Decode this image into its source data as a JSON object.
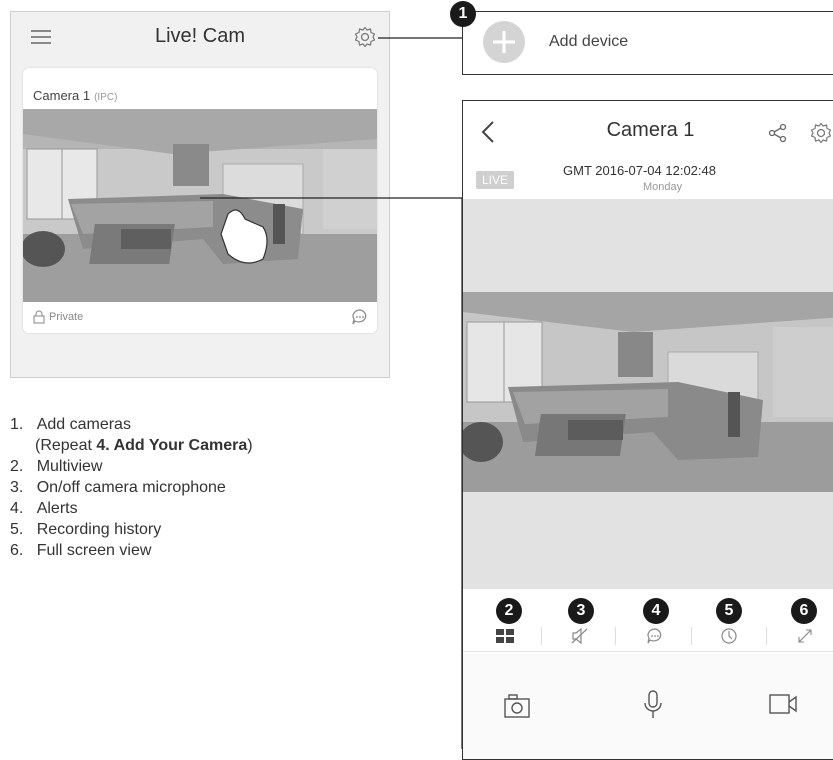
{
  "left_screen": {
    "title": "Live! Cam",
    "camera_name": "Camera 1",
    "camera_type": "(IPC)",
    "private_label": "Private"
  },
  "add_device": {
    "callout_number": "1",
    "label": "Add device"
  },
  "right_screen": {
    "title": "Camera 1",
    "live_badge": "LIVE",
    "timestamp": "GMT  2016-07-04  12:02:48",
    "weekday": "Monday",
    "callouts": [
      "2",
      "3",
      "4",
      "5",
      "6"
    ]
  },
  "instructions": {
    "items": [
      {
        "num": "1.",
        "text": "Add cameras"
      },
      {
        "num": "",
        "text_prefix": "(Repeat ",
        "text_bold": "4. Add Your Camera",
        "text_suffix": ")"
      },
      {
        "num": "2.",
        "text": "Multiview"
      },
      {
        "num": "3.",
        "text": "On/off camera microphone"
      },
      {
        "num": "4.",
        "text": "Alerts"
      },
      {
        "num": "5.",
        "text": "Recording history"
      },
      {
        "num": "6.",
        "text": "Full screen view"
      }
    ]
  },
  "colors": {
    "accent_dark": "#1a1a1a",
    "panel_bg": "#f1f1f1",
    "icon_gray": "#888888"
  }
}
